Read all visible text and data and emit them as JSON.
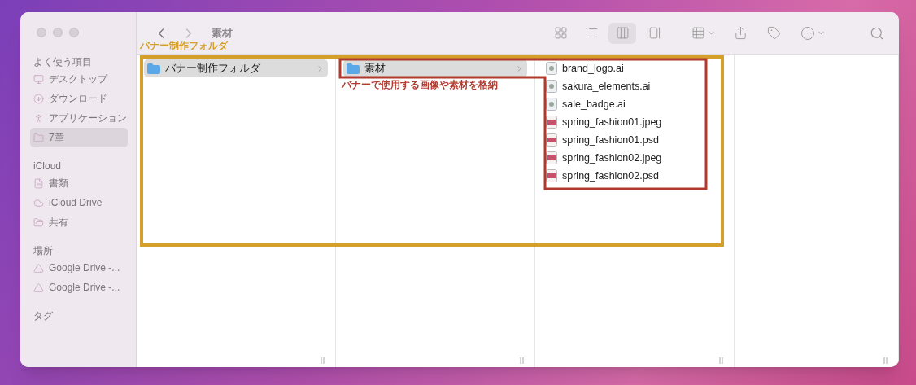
{
  "window": {
    "title": "素材"
  },
  "toolbar": {
    "view_modes": [
      {
        "kind": "icons",
        "selected": false
      },
      {
        "kind": "list",
        "selected": false
      },
      {
        "kind": "columns",
        "selected": true
      },
      {
        "kind": "gallery",
        "selected": false
      }
    ]
  },
  "sidebar": {
    "sections": [
      {
        "title": "よく使う項目",
        "items": [
          {
            "label": "デスクトップ",
            "kind": "desktop",
            "selected": false
          },
          {
            "label": "ダウンロード",
            "kind": "download",
            "selected": false
          },
          {
            "label": "アプリケーション",
            "kind": "apps",
            "selected": false
          },
          {
            "label": "7章",
            "kind": "folder",
            "selected": true
          }
        ]
      },
      {
        "title": "iCloud",
        "items": [
          {
            "label": "書類",
            "kind": "document",
            "selected": false
          },
          {
            "label": "iCloud Drive",
            "kind": "cloud",
            "selected": false
          },
          {
            "label": "共有",
            "kind": "shared",
            "selected": false
          }
        ]
      },
      {
        "title": "場所",
        "items": [
          {
            "label": "Google Drive -...",
            "kind": "drive",
            "selected": false
          },
          {
            "label": "Google Drive -...",
            "kind": "drive",
            "selected": false
          }
        ]
      },
      {
        "title": "タグ"
      }
    ]
  },
  "columns": [
    {
      "items": [
        {
          "label": "バナー制作フォルダ",
          "kind": "folder",
          "selected": true
        }
      ]
    },
    {
      "items": [
        {
          "label": "素材",
          "kind": "folder",
          "selected": true
        }
      ]
    },
    {
      "items": [
        {
          "label": "brand_logo.ai",
          "kind": "ai",
          "selected": false
        },
        {
          "label": "sakura_elements.ai",
          "kind": "ai",
          "selected": false
        },
        {
          "label": "sale_badge.ai",
          "kind": "ai",
          "selected": false
        },
        {
          "label": "spring_fashion01.jpeg",
          "kind": "image",
          "selected": false
        },
        {
          "label": "spring_fashion01.psd",
          "kind": "image",
          "selected": false
        },
        {
          "label": "spring_fashion02.jpeg",
          "kind": "image",
          "selected": false
        },
        {
          "label": "spring_fashion02.psd",
          "kind": "image",
          "selected": false
        }
      ]
    },
    {}
  ],
  "annotations": [
    {
      "label": "バナー制作フォルダ",
      "color": "#d4a02a"
    },
    {
      "label": "バナーで使用する画像や素材を格納",
      "color": "#b03a2e"
    }
  ]
}
